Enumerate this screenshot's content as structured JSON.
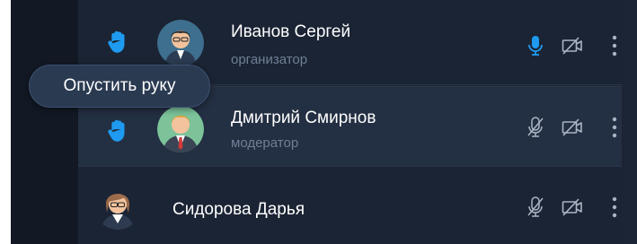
{
  "participants": [
    {
      "name": "Иванов Сергей",
      "role": "организатор",
      "hand_raised": true,
      "mic": "on",
      "camera": "off"
    },
    {
      "name": "Дмитрий Смирнов",
      "role": "модератор",
      "hand_raised": true,
      "mic": "muted",
      "camera": "off"
    },
    {
      "name": "Сидорова Дарья",
      "role": "",
      "hand_raised": false,
      "mic": "muted",
      "camera": "off"
    }
  ],
  "tooltip": {
    "text": "Опустить руку"
  },
  "colors": {
    "background": "#1c2535",
    "row_highlight": "#232f42",
    "sidebar": "#121924",
    "accent": "#1e9bf0",
    "icon_muted": "#aab4c3",
    "role_text": "#6f7f97"
  },
  "icons": {
    "hand": "raised-hand-icon",
    "mic_on": "microphone-icon",
    "mic_muted": "microphone-muted-icon",
    "camera_off": "camera-off-icon",
    "more": "more-vertical-icon"
  }
}
